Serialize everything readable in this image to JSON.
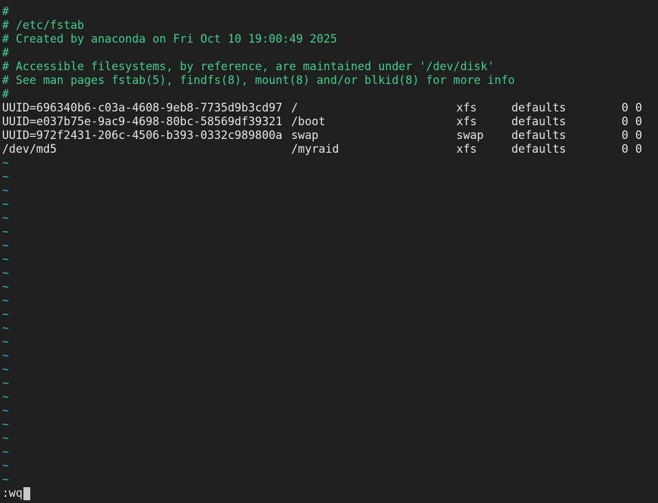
{
  "editor": {
    "comments": [
      "#",
      "# /etc/fstab",
      "# Created by anaconda on Fri Oct 10 19:00:49 2025",
      "#",
      "# Accessible filesystems, by reference, are maintained under '/dev/disk'",
      "# See man pages fstab(5), findfs(8), mount(8) and/or blkid(8) for more info",
      "#"
    ],
    "entries": [
      {
        "device": "UUID=696340b6-c03a-4608-9eb8-7735d9b3cd97",
        "mount": "/",
        "type": "xfs",
        "options": "defaults",
        "dump": "0",
        "pass": "0"
      },
      {
        "device": "UUID=e037b75e-9ac9-4698-80bc-58569df39321",
        "mount": "/boot",
        "type": "xfs",
        "options": "defaults",
        "dump": "0",
        "pass": "0"
      },
      {
        "device": "UUID=972f2431-206c-4506-b393-0332c989800a",
        "mount": "swap",
        "type": "swap",
        "options": "defaults",
        "dump": "0",
        "pass": "0"
      },
      {
        "device": "/dev/md5",
        "mount": "/myraid",
        "type": "xfs",
        "options": "defaults",
        "dump": "0",
        "pass": "0"
      }
    ],
    "empty_line_marker": "~",
    "empty_line_count": 24,
    "comment_color": "#3ad18c",
    "tilde_color": "#22b5c9",
    "background_color": "#1f1f1f"
  },
  "command_line": {
    "text": ":wq"
  }
}
